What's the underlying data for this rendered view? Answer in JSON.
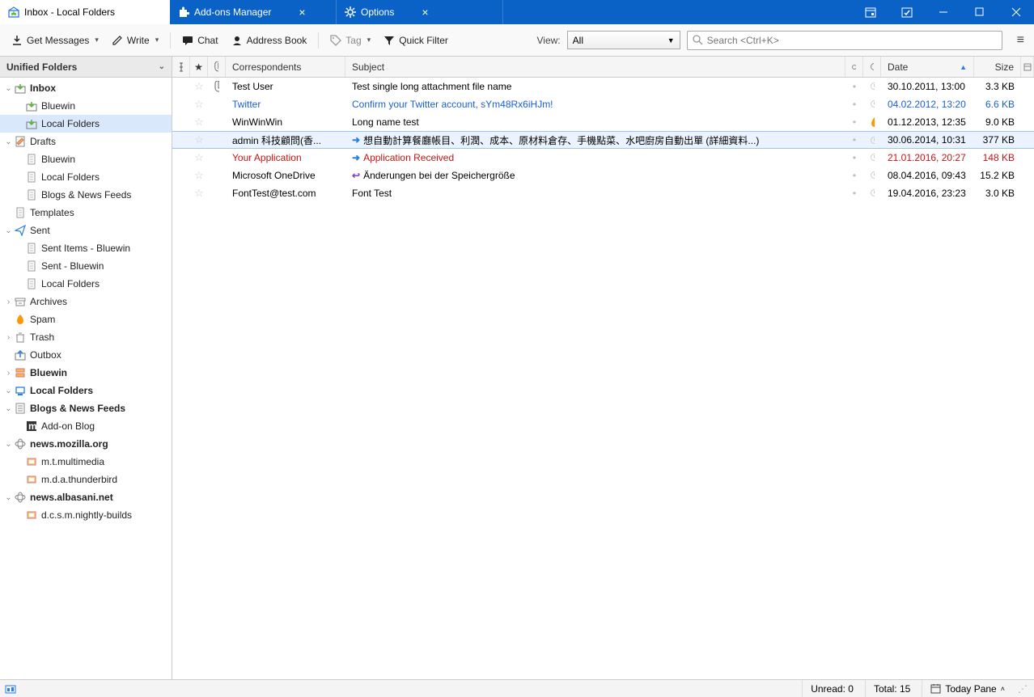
{
  "tabs": [
    {
      "label": "Inbox - Local Folders",
      "icon": "inbox"
    },
    {
      "label": "Add-ons Manager",
      "icon": "puzzle"
    },
    {
      "label": "Options",
      "icon": "gear"
    }
  ],
  "toolbar": {
    "get_messages": "Get Messages",
    "write": "Write",
    "chat": "Chat",
    "address_book": "Address Book",
    "tag": "Tag",
    "quick_filter": "Quick Filter",
    "view_label": "View:",
    "view_value": "All",
    "search_placeholder": "Search <Ctrl+K>"
  },
  "sidebar": {
    "header": "Unified Folders",
    "items": [
      {
        "label": "Inbox",
        "icon": "inbox",
        "twisty": "open",
        "indent": 0,
        "bold": true
      },
      {
        "label": "Bluewin",
        "icon": "inbox",
        "twisty": "",
        "indent": 1
      },
      {
        "label": "Local Folders",
        "icon": "inbox",
        "twisty": "",
        "indent": 1,
        "selected": true
      },
      {
        "label": "Drafts",
        "icon": "draft",
        "twisty": "open",
        "indent": 0
      },
      {
        "label": "Bluewin",
        "icon": "file",
        "twisty": "",
        "indent": 1
      },
      {
        "label": "Local Folders",
        "icon": "file",
        "twisty": "",
        "indent": 1
      },
      {
        "label": "Blogs & News Feeds",
        "icon": "file",
        "twisty": "",
        "indent": 1
      },
      {
        "label": "Templates",
        "icon": "file",
        "twisty": "",
        "indent": 0
      },
      {
        "label": "Sent",
        "icon": "sent",
        "twisty": "open",
        "indent": 0
      },
      {
        "label": "Sent Items - Bluewin",
        "icon": "file",
        "twisty": "",
        "indent": 1
      },
      {
        "label": "Sent - Bluewin",
        "icon": "file",
        "twisty": "",
        "indent": 1
      },
      {
        "label": "Local Folders",
        "icon": "file",
        "twisty": "",
        "indent": 1
      },
      {
        "label": "Archives",
        "icon": "archive",
        "twisty": "closed",
        "indent": 0
      },
      {
        "label": "Spam",
        "icon": "spam",
        "twisty": "",
        "indent": 0
      },
      {
        "label": "Trash",
        "icon": "trash",
        "twisty": "closed",
        "indent": 0
      },
      {
        "label": "Outbox",
        "icon": "outbox",
        "twisty": "",
        "indent": 0
      },
      {
        "label": "Bluewin",
        "icon": "server",
        "twisty": "closed",
        "indent": 0,
        "bold": true
      },
      {
        "label": "Local Folders",
        "icon": "local",
        "twisty": "open",
        "indent": 0,
        "bold": true
      },
      {
        "label": "Blogs & News Feeds",
        "icon": "feed",
        "twisty": "open",
        "indent": 0,
        "bold": true
      },
      {
        "label": "Add-on Blog",
        "icon": "feeditem",
        "twisty": "",
        "indent": 1
      },
      {
        "label": "news.mozilla.org",
        "icon": "news",
        "twisty": "open",
        "indent": 0,
        "bold": true
      },
      {
        "label": "m.t.multimedia",
        "icon": "newsgroup",
        "twisty": "",
        "indent": 1
      },
      {
        "label": "m.d.a.thunderbird",
        "icon": "newsgroup",
        "twisty": "",
        "indent": 1
      },
      {
        "label": "news.albasani.net",
        "icon": "news",
        "twisty": "open",
        "indent": 0,
        "bold": true
      },
      {
        "label": "d.c.s.m.nightly-builds",
        "icon": "newsgroup",
        "twisty": "",
        "indent": 1
      }
    ]
  },
  "columns": {
    "correspondents": "Correspondents",
    "subject": "Subject",
    "date": "Date",
    "size": "Size"
  },
  "messages": [
    {
      "from": "Test User",
      "subject": "Test single long attachment file name",
      "date": "30.10.2011, 13:00",
      "size": "3.3 KB",
      "attach": true,
      "hot": false,
      "arrow": "",
      "color": ""
    },
    {
      "from": "Twitter",
      "subject": "Confirm your Twitter account, sYm48Rx6iHJm!",
      "date": "04.02.2012, 13:20",
      "size": "6.6 KB",
      "attach": false,
      "hot": false,
      "arrow": "",
      "color": "link"
    },
    {
      "from": "WinWinWin",
      "subject": "Long name test",
      "date": "01.12.2013, 12:35",
      "size": "9.0 KB",
      "attach": false,
      "hot": true,
      "arrow": "",
      "color": ""
    },
    {
      "from": "admin 科技顧問(香...",
      "subject": "想自動計算餐廳帳目、利潤、成本、原材料倉存、手機點菜、水吧廚房自動出單 (詳細資料...)",
      "date": "30.06.2014, 10:31",
      "size": "377 KB",
      "attach": false,
      "hot": false,
      "arrow": "fwd",
      "color": "",
      "selected": true
    },
    {
      "from": "Your Application",
      "subject": "Application Received",
      "date": "21.01.2016, 20:27",
      "size": "148 KB",
      "attach": false,
      "hot": false,
      "arrow": "fwd",
      "color": "red"
    },
    {
      "from": "Microsoft OneDrive",
      "subject": "Änderungen bei der Speichergröße",
      "date": "08.04.2016, 09:43",
      "size": "15.2 KB",
      "attach": false,
      "hot": false,
      "arrow": "reply",
      "color": ""
    },
    {
      "from": "FontTest@test.com",
      "subject": "Font Test",
      "date": "19.04.2016, 23:23",
      "size": "3.0 KB",
      "attach": false,
      "hot": false,
      "arrow": "",
      "color": ""
    }
  ],
  "statusbar": {
    "unread_label": "Unread:",
    "unread_value": "0",
    "total_label": "Total:",
    "total_value": "15",
    "today_pane": "Today Pane"
  }
}
